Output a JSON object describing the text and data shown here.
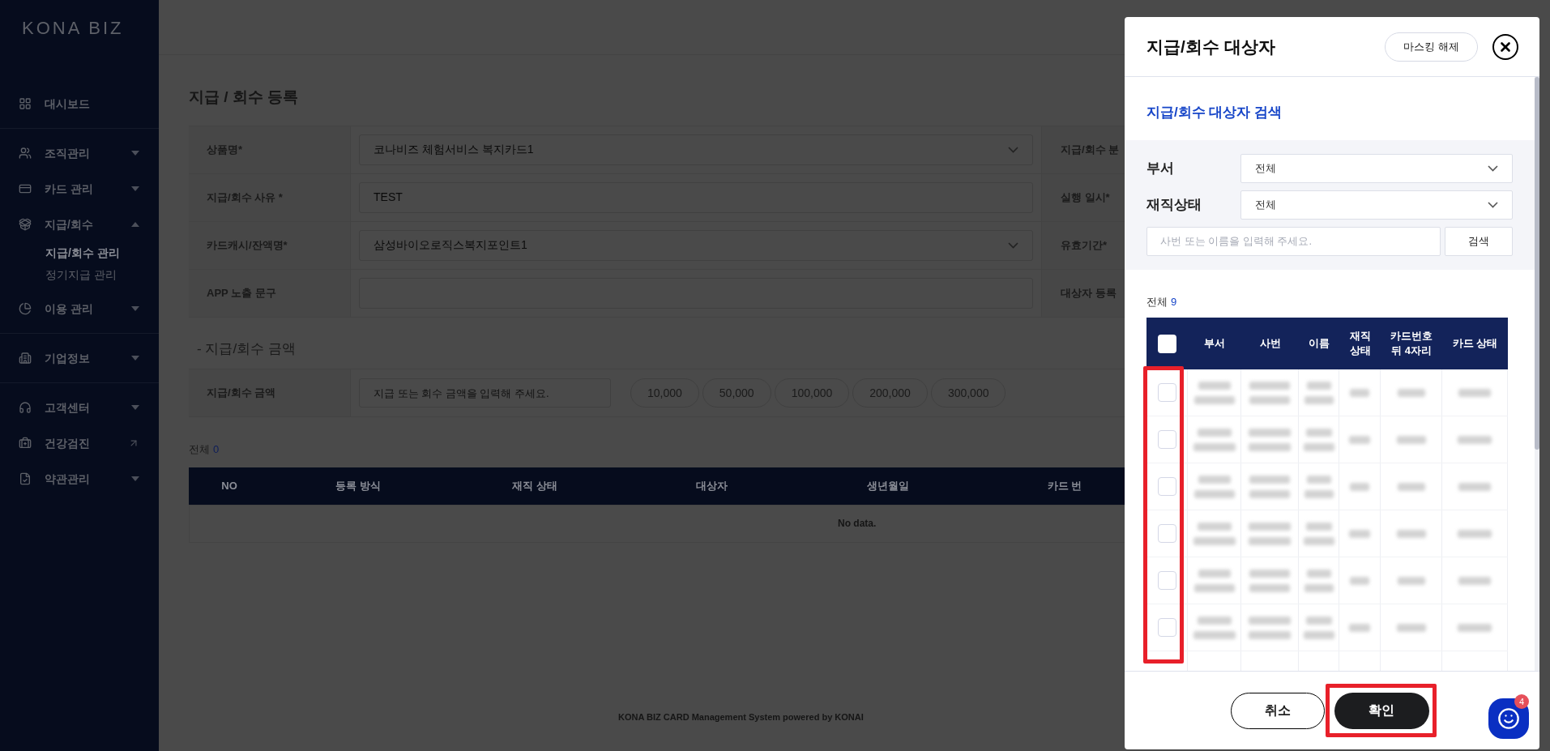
{
  "sidebar": {
    "logo": "KONA BIZ",
    "groups": [
      [
        {
          "label": "대시보드",
          "kind": "plain"
        }
      ],
      [
        {
          "label": "조직관리",
          "kind": "expandable",
          "expanded": false
        },
        {
          "label": "카드 관리",
          "kind": "expandable",
          "expanded": false
        },
        {
          "label": "지급/회수",
          "kind": "expandable",
          "expanded": true,
          "children": [
            {
              "label": "지급/회수 관리",
              "selected": true
            },
            {
              "label": "정기지급 관리",
              "selected": false
            }
          ]
        },
        {
          "label": "이용 관리",
          "kind": "expandable",
          "expanded": false
        }
      ],
      [
        {
          "label": "기업정보",
          "kind": "expandable",
          "expanded": false
        }
      ],
      [
        {
          "label": "고객센터",
          "kind": "expandable",
          "expanded": false
        },
        {
          "label": "건강검진",
          "kind": "external"
        },
        {
          "label": "약관관리",
          "kind": "expandable",
          "expanded": false
        }
      ]
    ]
  },
  "page": {
    "title": "지급 / 회수 등록",
    "form_rows": [
      {
        "label": "상품명*",
        "kind": "select",
        "value": "코나비즈 체험서비스 복지카드1",
        "label_2": "지급/회수 분"
      },
      {
        "label": "지급/회수 사유 *",
        "kind": "input",
        "value": "TEST",
        "label_2": "실행 일시*"
      },
      {
        "label": "카드캐시/잔액명*",
        "kind": "select",
        "value": "삼성바이오로직스복지포인트1",
        "label_2": "유효기간*"
      },
      {
        "label": "APP 노출 문구",
        "kind": "input",
        "label_2": "대상자 등록"
      }
    ],
    "amount_section": "- 지급/회수 금액",
    "amount_label": "지급/회수 금액",
    "amount_placeholder": "지급 또는 회수 금액을 입력해 주세요.",
    "amount_buttons": [
      "10,000",
      "50,000",
      "100,000",
      "200,000",
      "300,000"
    ],
    "total_label": "전체",
    "total_count": "0",
    "table": {
      "columns": [
        "NO",
        "등록 방식",
        "재직 상태",
        "대상자",
        "생년월일",
        "카드 번"
      ],
      "empty": "No data."
    },
    "footer": "KONA BIZ CARD Management System powered by KONAI"
  },
  "modal": {
    "title": "지급/회수 대상자",
    "unmask_button": "마스킹 해제",
    "section_title": "지급/회수 대상자 검색",
    "filters": [
      {
        "label": "부서",
        "value": "전체"
      },
      {
        "label": "재직상태",
        "value": "전체"
      }
    ],
    "search_placeholder": "사번 또는 이름을 입력해 주세요.",
    "search_button": "검색",
    "total_label": "전체",
    "total_count": "9",
    "columns": [
      "부서",
      "사번",
      "이름",
      "재직\n상태",
      "카드번호\n뒤 4자리",
      "카드 상태"
    ],
    "select_all_checked": false,
    "checkbox_column_highlighted": true,
    "rows": [
      {
        "checked": false
      },
      {
        "checked": false
      },
      {
        "checked": false
      },
      {
        "checked": false
      },
      {
        "checked": false
      },
      {
        "checked": false
      }
    ],
    "cancel_button": "취소",
    "confirm_button": "확인",
    "confirm_highlighted": true
  },
  "chat": {
    "badge": "4"
  }
}
